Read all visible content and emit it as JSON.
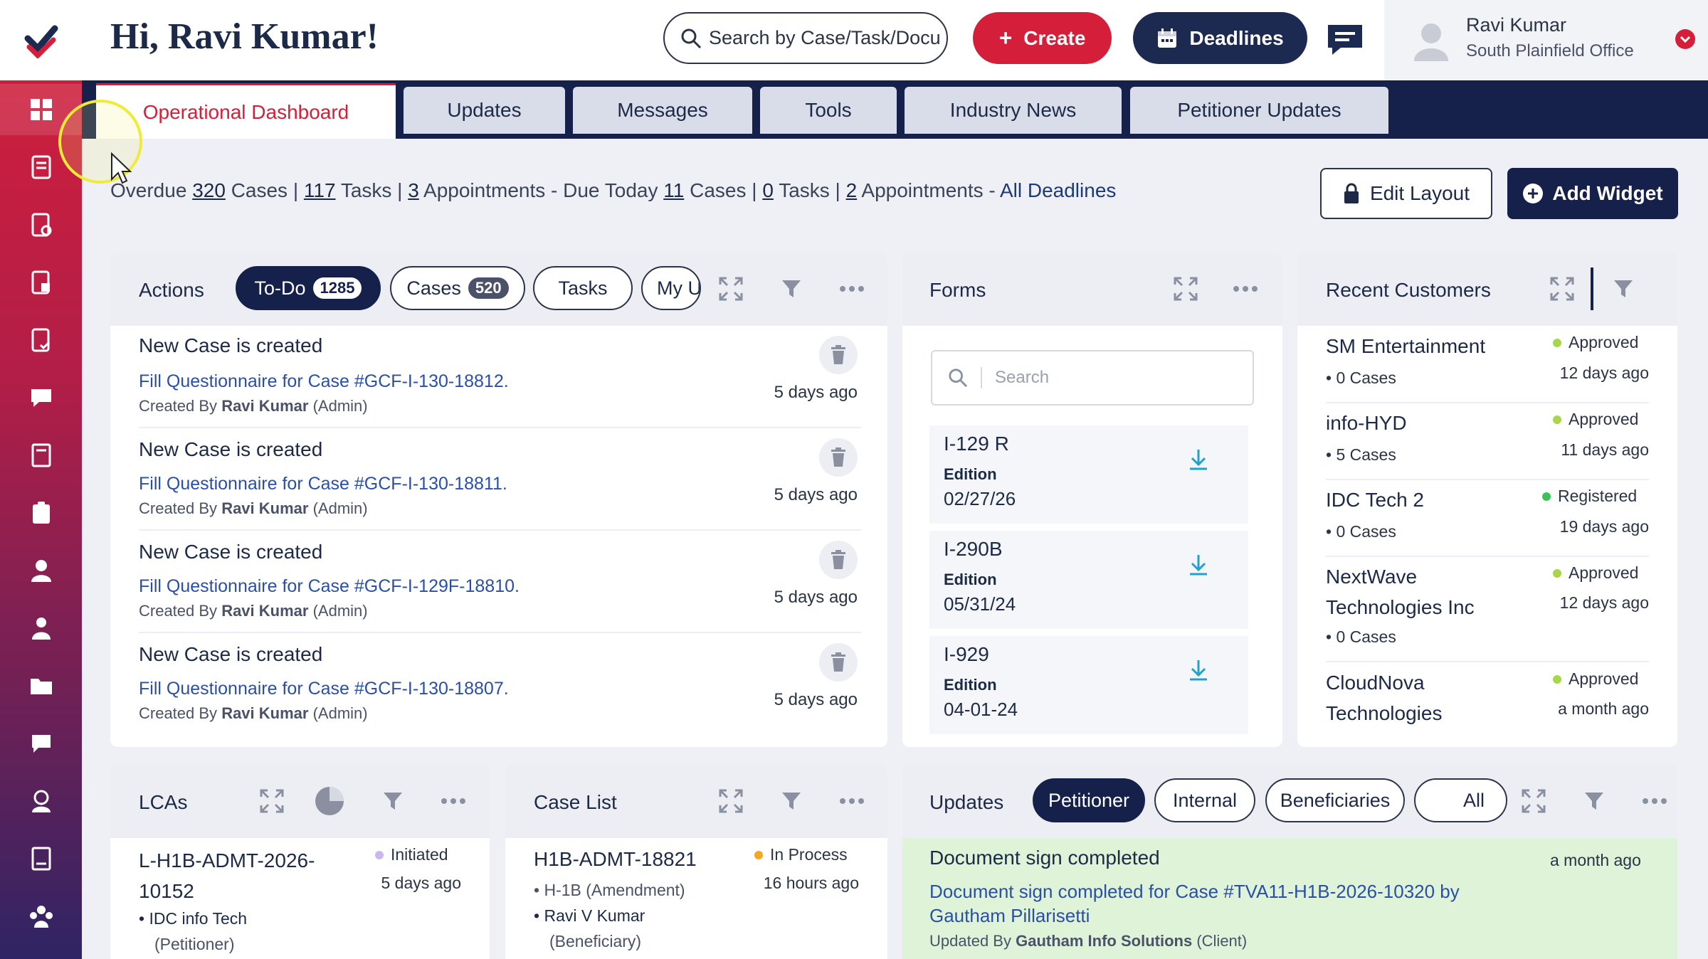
{
  "header": {
    "greeting": "Hi, Ravi Kumar!",
    "search_text": "Search by Case/Task/Docu",
    "create_label": "Create",
    "deadlines_label": "Deadlines",
    "user_name": "Ravi Kumar",
    "user_office": "South Plainfield Office"
  },
  "sidebar": {
    "items": [
      "dashboard-icon",
      "document-icon",
      "document-check-icon",
      "document-stack-icon",
      "form-check-icon",
      "chat-icon",
      "book-icon",
      "clipboard-icon",
      "user-icon",
      "people-icon",
      "folder-icon",
      "message-icon",
      "support-agent-icon",
      "report-icon",
      "team-icon"
    ]
  },
  "tabs": [
    {
      "label": "Operational Dashboard",
      "active": true
    },
    {
      "label": "Updates"
    },
    {
      "label": "Messages"
    },
    {
      "label": "Tools"
    },
    {
      "label": "Industry News"
    },
    {
      "label": "Petitioner Updates"
    }
  ],
  "status": {
    "overdue_prefix": "Overdue",
    "overdue_cases": "320",
    "cases_word": "Cases |",
    "overdue_tasks": "117",
    "tasks_word": "Tasks |",
    "overdue_appts": "3",
    "appts_due_today": "Appointments - Due Today",
    "today_cases": "11",
    "today_cases_word": "Cases |",
    "today_tasks": "0",
    "today_tasks_word": "Tasks |",
    "today_appts": "2",
    "today_appts_word": "Appointments -",
    "all_deadlines": "All Deadlines"
  },
  "layout_buttons": {
    "edit_layout": "Edit Layout",
    "add_widget": "Add Widget"
  },
  "actions_widget": {
    "title": "Actions",
    "chips": [
      {
        "label": "To-Do",
        "count": "1285"
      },
      {
        "label": "Cases",
        "count": "520"
      },
      {
        "label": "Tasks"
      },
      {
        "label": "My U"
      }
    ],
    "items": [
      {
        "title": "New Case is created",
        "link": "Fill Questionnaire for Case #GCF-I-130-18812.",
        "by_prefix": "Created By",
        "by_name": "Ravi Kumar",
        "by_role": "(Admin)",
        "time": "5 days ago"
      },
      {
        "title": "New Case is created",
        "link": "Fill Questionnaire for Case #GCF-I-130-18811.",
        "by_prefix": "Created By",
        "by_name": "Ravi Kumar",
        "by_role": "(Admin)",
        "time": "5 days ago"
      },
      {
        "title": "New Case is created",
        "link": "Fill Questionnaire for Case #GCF-I-129F-18810.",
        "by_prefix": "Created By",
        "by_name": "Ravi Kumar",
        "by_role": "(Admin)",
        "time": "5 days ago"
      },
      {
        "title": "New Case is created",
        "link": "Fill Questionnaire for Case #GCF-I-130-18807.",
        "by_prefix": "Created By",
        "by_name": "Ravi Kumar",
        "by_role": "(Admin)",
        "time": "5 days ago"
      }
    ]
  },
  "forms_widget": {
    "title": "Forms",
    "search_placeholder": "Search",
    "items": [
      {
        "name": "I-129 R",
        "edition_label": "Edition",
        "date": "02/27/26"
      },
      {
        "name": "I-290B",
        "edition_label": "Edition",
        "date": "05/31/24"
      },
      {
        "name": "I-929",
        "edition_label": "Edition",
        "date": "04-01-24"
      }
    ]
  },
  "customers_widget": {
    "title": "Recent Customers",
    "items": [
      {
        "name1": "SM Entertainment",
        "name2": "",
        "cases": "0 Cases",
        "status": "Approved",
        "status_color": "#a6d64a",
        "time": "12 days ago"
      },
      {
        "name1": "info-HYD",
        "name2": "",
        "cases": "5 Cases",
        "status": "Approved",
        "status_color": "#a6d64a",
        "time": "11 days ago"
      },
      {
        "name1": "IDC Tech 2",
        "name2": "",
        "cases": "0 Cases",
        "status": "Registered",
        "status_color": "#37c35a",
        "time": "19 days ago"
      },
      {
        "name1": "NextWave",
        "name2": "Technologies Inc",
        "cases": "0 Cases",
        "status": "Approved",
        "status_color": "#a6d64a",
        "time": "12 days ago"
      },
      {
        "name1": "CloudNova",
        "name2": "Technologies",
        "cases": "",
        "status": "Approved",
        "status_color": "#a6d64a",
        "time": "a month ago"
      }
    ]
  },
  "lcas_widget": {
    "title": "LCAs",
    "item": {
      "id_line1": "L-H1B-ADMT-2026-",
      "id_line2": "10152",
      "status": "Initiated",
      "status_color": "#c9b8f0",
      "time": "5 days ago",
      "company": "IDC info Tech",
      "role": "(Petitioner)"
    }
  },
  "caselist_widget": {
    "title": "Case List",
    "item": {
      "id": "H1B-ADMT-18821",
      "status": "In Process",
      "status_color": "#f5a623",
      "time": "16 hours ago",
      "type": "H-1B (Amendment)",
      "person": "Ravi V Kumar",
      "role": "(Beneficiary)"
    }
  },
  "updates_widget": {
    "title": "Updates",
    "chips": [
      "Petitioner",
      "Internal",
      "Beneficiaries",
      "All"
    ],
    "item": {
      "title": "Document sign completed",
      "text_line1": "Document sign completed for Case #TVA11-H1B-2026-10320 by",
      "text_line2": "Gautham Pillarisetti",
      "by_prefix": "Updated By",
      "by_name": "Gautham Info Solutions",
      "by_role": "(Client)",
      "time": "a month ago"
    }
  },
  "colors": {
    "brand_red": "#d51f3a",
    "navy": "#15214a",
    "update_bg": "#dff3d8"
  }
}
